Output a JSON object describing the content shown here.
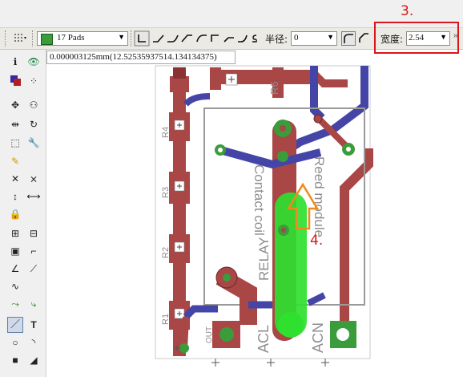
{
  "toolbar": {
    "pads_value": "17 Pads",
    "radius_label": "半径:",
    "radius_value": "0",
    "width_label": "宽度:",
    "width_value": "2.54"
  },
  "coordinate_readout": "0.000003125mm(12.52535937514.134134375)",
  "annotations": {
    "step3": "3.",
    "step4": "4."
  },
  "pcb": {
    "silkscreen_labels": [
      "R6",
      "R4",
      "R3",
      "R2",
      "R1",
      "RELAY",
      "OUT",
      "ACL",
      "ACN",
      "Contact coil",
      "Reed module"
    ],
    "plus_marks": [
      "+"
    ]
  },
  "colors": {
    "copper_red": "#a94646",
    "copper_blue": "#4545a8",
    "pad_green": "#3a9c3a",
    "highlight_green": "#2fe02f",
    "annotation_red": "#d8161b",
    "arrow_orange": "#f08a1c"
  }
}
